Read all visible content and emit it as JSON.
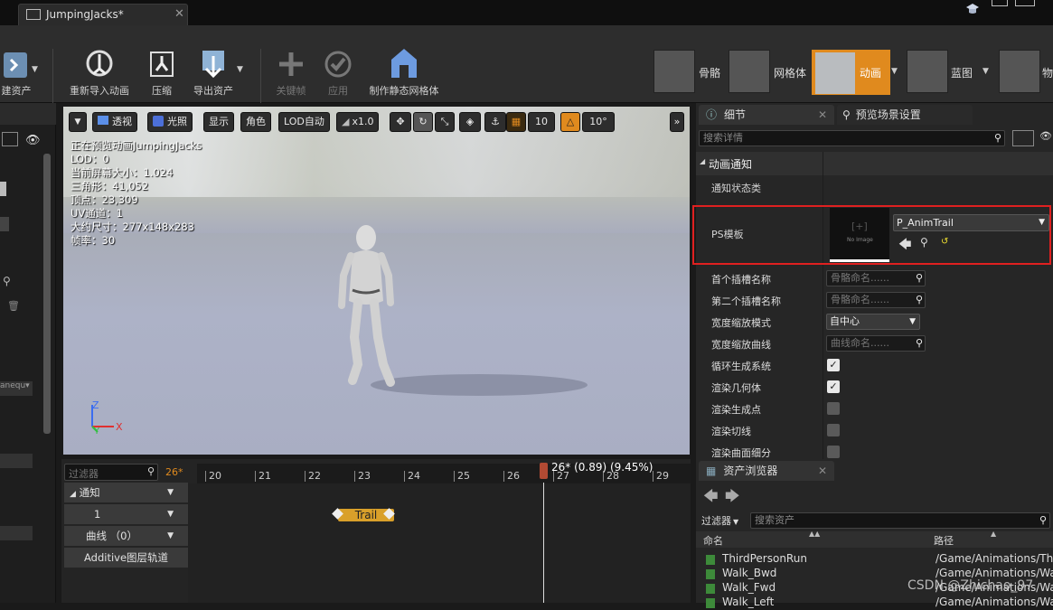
{
  "window": {
    "tab_title": "JumpingJacks*",
    "close": "✕"
  },
  "toolbar": {
    "items": [
      {
        "label": "建资产"
      },
      {
        "label": "重新导入动画"
      },
      {
        "label": "压缩"
      },
      {
        "label": "导出资产"
      },
      {
        "label": "关键帧",
        "disabled": true
      },
      {
        "label": "应用",
        "disabled": true
      },
      {
        "label": "制作静态网格体"
      }
    ],
    "modes": [
      {
        "label": "骨骼"
      },
      {
        "label": "网格体"
      },
      {
        "label": "动画",
        "active": true
      },
      {
        "label": "蓝图"
      },
      {
        "label": "物"
      }
    ]
  },
  "viewport": {
    "buttons": {
      "perspective": "透视",
      "lighting": "光照",
      "show": "显示",
      "character": "角色",
      "lod": "LOD自动",
      "speed": "x1.0",
      "grid": "10",
      "angle": "10°"
    },
    "overlay": [
      "正在预览动画JumpingJacks",
      "LOD：0",
      "当前屏幕大小：1.024",
      "三角形：41,052",
      "顶点：23,309",
      "UV通道：1",
      "大约尺寸：277x148x283",
      "帧率：30"
    ],
    "axes": {
      "z": "Z",
      "x": "X",
      "y": "Y"
    }
  },
  "timeline": {
    "filter_placeholder": "过滤器",
    "current_frame": "26*",
    "frames": [
      "20",
      "21",
      "22",
      "23",
      "24",
      "25",
      "26",
      "27",
      "28",
      "29"
    ],
    "playhead": "26* (0.89) (9.45%)",
    "tracks": {
      "notify": "通知",
      "notify_row": "1",
      "curves": "曲线 （0）",
      "additive": "Additive图层轨道"
    },
    "notify_item": "Trail"
  },
  "details": {
    "tabs": {
      "details": "细节",
      "preview": "预览场景设置"
    },
    "search_placeholder": "搜索详情",
    "category": "动画通知",
    "state_class": "通知状态类",
    "ps_template": {
      "label": "PS模板",
      "thumb": "No Image",
      "value": "P_AnimTrail"
    },
    "rows": [
      {
        "label": "首个插槽名称",
        "kind": "field",
        "value": "骨骼命名......"
      },
      {
        "label": "第二个插槽名称",
        "kind": "field",
        "value": "骨骼命名......"
      },
      {
        "label": "宽度缩放模式",
        "kind": "select",
        "value": "自中心"
      },
      {
        "label": "宽度缩放曲线",
        "kind": "field",
        "value": "曲线命名......"
      },
      {
        "label": "循环生成系统",
        "kind": "check",
        "checked": true
      },
      {
        "label": "渲染几何体",
        "kind": "check",
        "checked": true
      },
      {
        "label": "渲染生成点",
        "kind": "check",
        "checked": false
      },
      {
        "label": "渲染切线",
        "kind": "check",
        "checked": false
      },
      {
        "label": "渲染曲面细分",
        "kind": "check",
        "checked": false
      }
    ]
  },
  "assets": {
    "tab": "资产浏览器",
    "filter_label": "过滤器",
    "search_placeholder": "搜索资产",
    "columns": {
      "name": "命名",
      "path": "路径"
    },
    "rows": [
      {
        "name": "ThirdPersonRun",
        "path": "/Game/Animations/Thi"
      },
      {
        "name": "Walk_Bwd",
        "path": "/Game/Animations/Wa"
      },
      {
        "name": "Walk_Fwd",
        "path": "/Game/Animations/Wa"
      },
      {
        "name": "Walk_Left",
        "path": "/Game/Animations/Wa"
      }
    ]
  },
  "watermark": "CSDN @Zhichao_97",
  "colors": {
    "accent": "#e08a1e",
    "highlight_box": "#e02020",
    "panel": "#262626"
  }
}
